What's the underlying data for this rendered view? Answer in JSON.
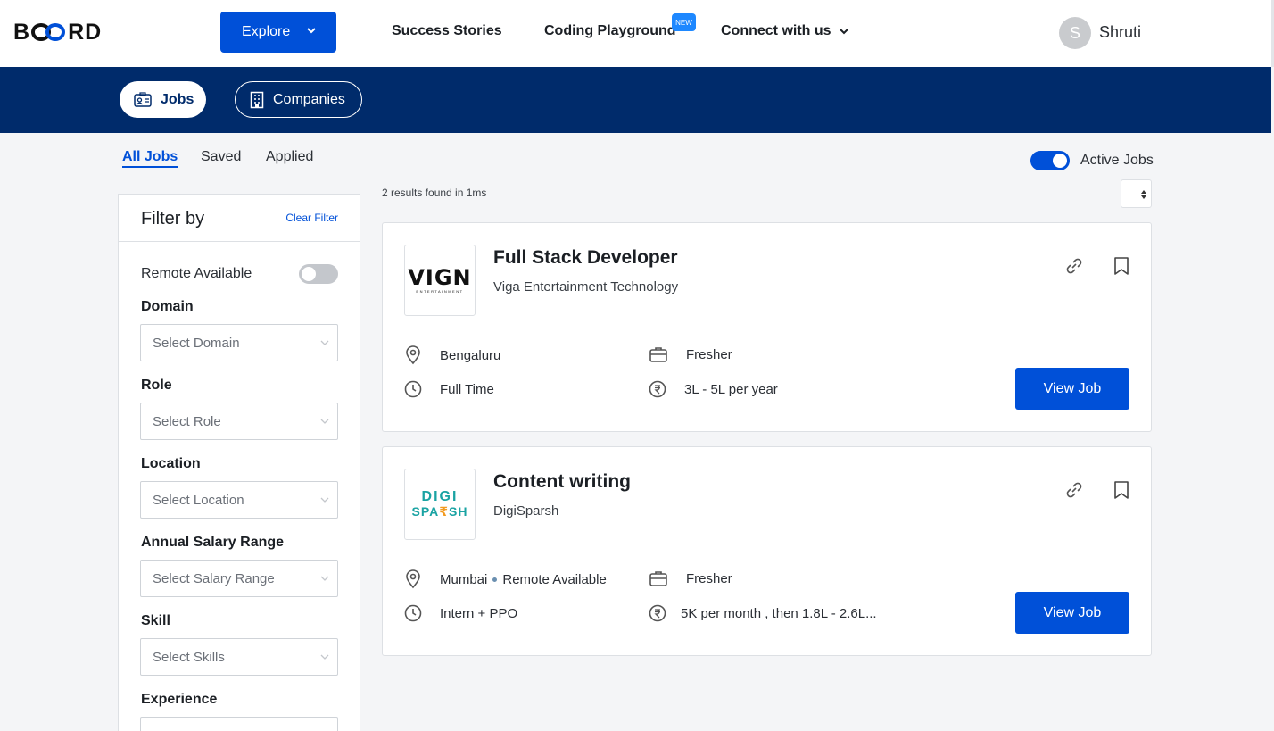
{
  "nav": {
    "logo_left": "B",
    "logo_right": "RD",
    "explore_label": "Explore",
    "success_stories": "Success Stories",
    "coding_playground": "Coding Playground",
    "new_badge": "NEW",
    "connect": "Connect with us",
    "avatar_initial": "S",
    "username": "Shruti"
  },
  "subbar": {
    "jobs_label": "Jobs",
    "companies_label": "Companies"
  },
  "tabs": {
    "all_jobs": "All Jobs",
    "saved": "Saved",
    "applied": "Applied"
  },
  "active_jobs": {
    "label": "Active Jobs",
    "on": true
  },
  "results_text": "2 results found in 1ms",
  "filter": {
    "title": "Filter by",
    "clear": "Clear Filter",
    "remote_label": "Remote Available",
    "remote_on": false,
    "domain_label": "Domain",
    "domain_placeholder": "Select Domain",
    "role_label": "Role",
    "role_placeholder": "Select Role",
    "location_label": "Location",
    "location_placeholder": "Select Location",
    "salary_label": "Annual Salary Range",
    "salary_placeholder": "Select Salary Range",
    "skill_label": "Skill",
    "skill_placeholder": "Select Skills",
    "experience_label": "Experience"
  },
  "jobs": [
    {
      "title": "Full Stack Developer",
      "company": "Viga Entertainment Technology",
      "logo_text": "VIGN",
      "logo_sub": "ENTERTAINMENT",
      "location": "Bengaluru",
      "experience": "Fresher",
      "type": "Full Time",
      "salary": "3L - 5L per year",
      "view_label": "View Job"
    },
    {
      "title": "Content writing",
      "company": "DigiSparsh",
      "logo_top": "DIGI",
      "logo_bot_a": "SPA",
      "logo_bot_r": "₹",
      "logo_bot_b": "SH",
      "location": "Mumbai",
      "remote": "Remote Available",
      "experience": "Fresher",
      "type": "Intern + PPO",
      "salary": "5K per month , then 1.8L - 2.6L...",
      "view_label": "View Job"
    }
  ],
  "colors": {
    "primary": "#0050d8",
    "navy": "#002b6b"
  }
}
